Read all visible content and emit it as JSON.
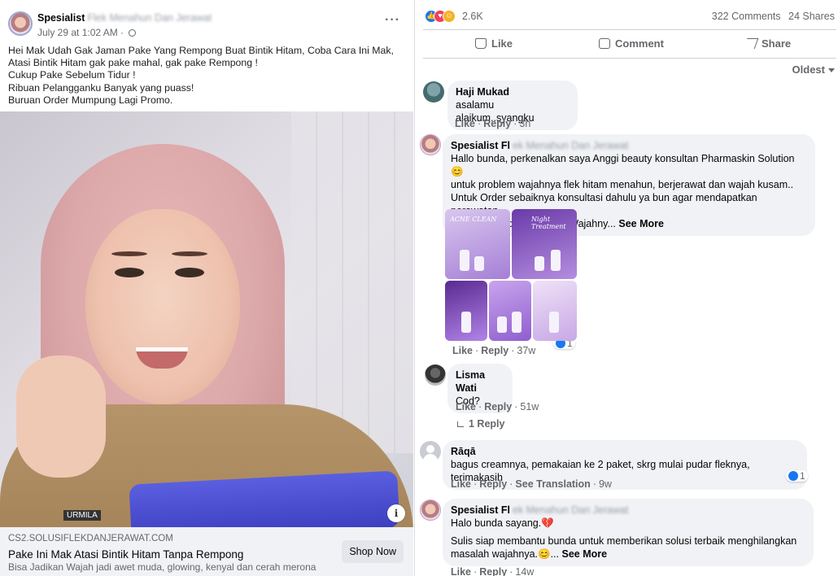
{
  "post": {
    "page_name": "Spesialist",
    "page_name_blurred": "Flek Menahun Dan Jerawat",
    "time": "July 29 at 1:02 AM · ",
    "more_icon": "more-horizontal-icon",
    "text_lines": [
      "Hei Mak Udah Gak Jaman Pake Yang Rempong Buat Bintik Hitam, Coba Cara Ini Mak, Atasi Bintik Hitam gak pake mahal, gak pake Rempong !",
      "Cukup Pake Sebelum Tidur !",
      "Ribuan Pelanggan­ku Banyak yang puass!",
      "Buruan Order Mumpung Lagi Promo."
    ],
    "image_text": "URMILA",
    "ad": {
      "url": "CS2.SOLUSIFLEKDANJERAWAT.COM",
      "title": "Pake Ini Mak Atasi Bintik Hitam Tanpa Rempong",
      "description": "Bisa Jadikan Wajah jadi awet muda, glowing, kenyal dan cerah merona",
      "button": "Shop Now",
      "info_icon": "i"
    }
  },
  "engagement": {
    "reaction_count": "2.6K",
    "comments": "322 Comments",
    "shares": "24 Shares",
    "actions": {
      "like": "Like",
      "comment": "Comment",
      "share": "Share"
    },
    "sort_label": "Oldest"
  },
  "comments": [
    {
      "name": "Haji Mukad",
      "text": "asalamu alaikum..syangku",
      "like": "Like",
      "reply": "Reply",
      "time": "3h"
    },
    {
      "name": "Spesialist Fl",
      "name_blurred": "ek Menahun Dan Jerawat",
      "text_lines": [
        "Hallo bunda, perkenalkan saya Anggi beauty konsultan Pharmaskin Solution 😊",
        "untuk problem wajahnya flek hitam menahun, berjerawat dan wajah kusam..",
        "Untuk Order sebaiknya konsultasi dahulu ya bun agar mendapatkan perawatan",
        "yang sesuai dgn masalah Wajahny..."
      ],
      "see_more": "See More",
      "tile_labels": [
        "ACNE CLEAN",
        "Night Treatment"
      ],
      "like": "Like",
      "reply": "Reply",
      "time": "37w",
      "react_count": "1"
    },
    {
      "name": "Lisma Wati",
      "text": "Cod?",
      "like": "Like",
      "reply": "Reply",
      "time": "51w",
      "replies": "1 Reply"
    },
    {
      "name": "Rāqā",
      "text": "bagus creamnya, pemakaian ke 2 paket, skrg mulai pudar fleknya, terimakasih",
      "like": "Like",
      "reply": "Reply",
      "translation": "See Translation",
      "time": "9w",
      "react_count": "1"
    },
    {
      "name": "Spesialist Fl",
      "name_blurred": "ek Menahun Dan Jerawat",
      "text_line1": "Halo bunda sayang.💔",
      "text_line2": "Sulis siap membantu bunda untuk memberikan solusi terbaik menghilangkan",
      "text_line3": "masalah wajahnya.😊...",
      "see_more": "See More",
      "like": "Like",
      "reply": "Reply",
      "time": "14w"
    }
  ],
  "colors": {
    "accent": "#1877f2",
    "secondary_text": "#65676b",
    "bubble": "#f0f2f5",
    "love": "#f33e58",
    "wow": "#f7b125"
  }
}
